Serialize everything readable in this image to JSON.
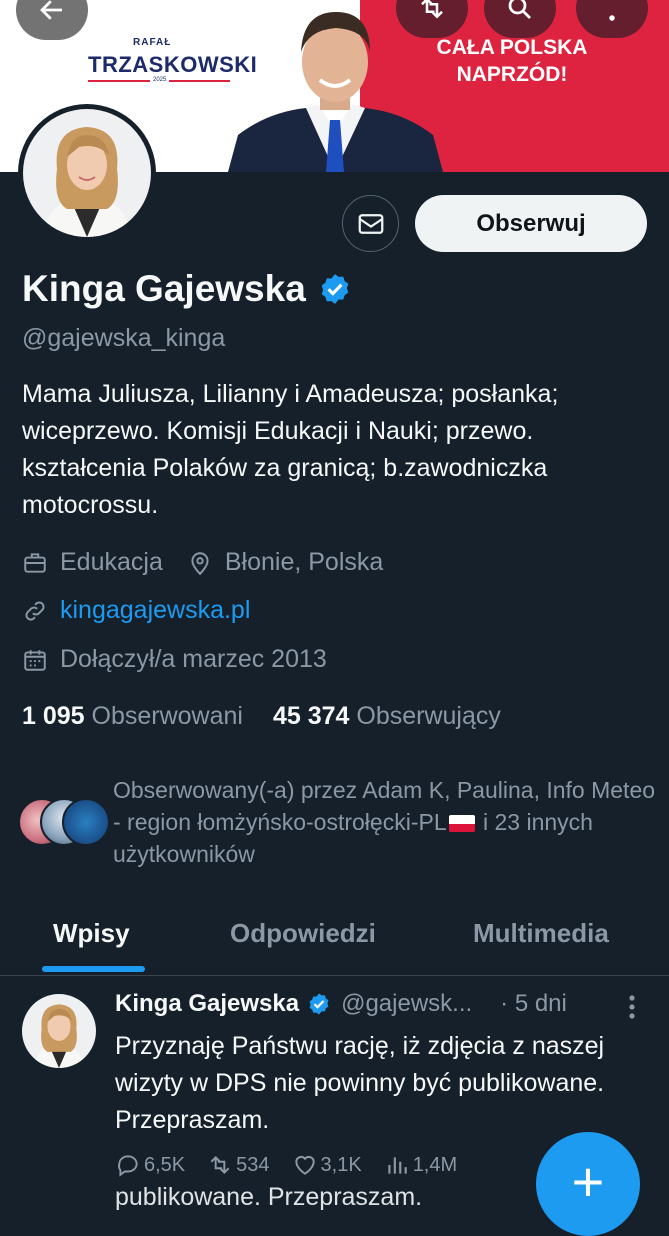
{
  "banner": {
    "brand_first": "RAFAŁ",
    "brand_last": "TRZASKOWSKI",
    "brand_year": "2025",
    "slogan_line1": "CAŁA POLSKA",
    "slogan_line2": "NAPRZÓD!"
  },
  "profile": {
    "name": "Kinga Gajewska",
    "handle": "@gajewska_kinga",
    "bio": "Mama Juliusza, Lilianny i Amadeusza; posłanka; wiceprzewo. Komisji Edukacji i Nauki; przewo. kształcenia Polaków za granicą; b.zawodniczka motocrossu.",
    "category": "Edukacja",
    "location": "Błonie, Polska",
    "website": "kingagajewska.pl",
    "joined": "Dołączył/a marzec 2013",
    "following_count": "1 095",
    "following_label": "Obserwowani",
    "followers_count": "45 374",
    "followers_label": "Obserwujący",
    "follow_button": "Obserwuj",
    "followed_by_part1": "Obserwowany(-a) przez Adam K, Paulina, Info Meteo - region łomżyńsko-ostrołęcki-PL",
    "followed_by_part2": " i 23 innych użytkowników"
  },
  "tabs": [
    "Wpisy",
    "Odpowiedzi",
    "Multimedia"
  ],
  "tweet": {
    "name": "Kinga Gajewska",
    "handle": "@gajewsk...",
    "time": "· 5 dni",
    "text": "Przyznaję Państwu rację, iż zdjęcia z naszej wizyty w DPS nie powinny być publikowane. Przepraszam.",
    "replies": "6,5K",
    "retweets": "534",
    "likes": "3,1K",
    "views": "1,4M",
    "ghost_text": "publikowane. Przepraszam."
  },
  "fab_label": "+",
  "colors": {
    "background": "#15202b",
    "accent": "#1d9bf0",
    "muted": "#8b98a5",
    "banner_red": "#de2340",
    "brand_navy": "#1d2b6b"
  },
  "icons": [
    "back-arrow-icon",
    "retweet-icon",
    "search-icon",
    "more-vertical-icon",
    "mail-icon",
    "verified-badge-icon",
    "briefcase-icon",
    "location-pin-icon",
    "link-icon",
    "calendar-icon",
    "reply-icon",
    "like-icon",
    "views-icon",
    "compose-plus-icon"
  ]
}
